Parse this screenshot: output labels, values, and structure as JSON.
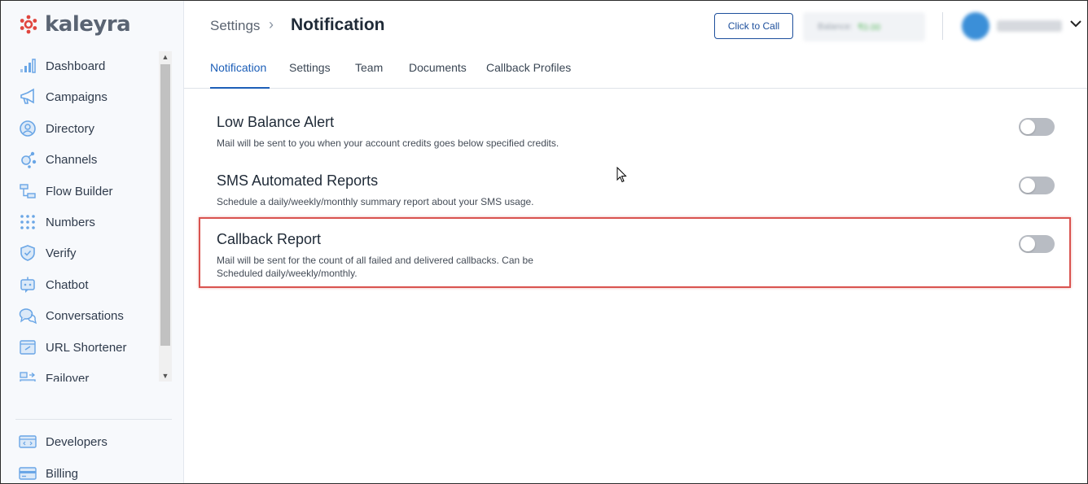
{
  "brand": {
    "name": "kaleyra",
    "accent": "#e0463f"
  },
  "sidebar": {
    "items": [
      {
        "label": "Dashboard",
        "icon": "bar-chart-icon"
      },
      {
        "label": "Campaigns",
        "icon": "megaphone-icon"
      },
      {
        "label": "Directory",
        "icon": "user-circle-icon"
      },
      {
        "label": "Channels",
        "icon": "channels-icon"
      },
      {
        "label": "Flow Builder",
        "icon": "flow-icon"
      },
      {
        "label": "Numbers",
        "icon": "keypad-icon"
      },
      {
        "label": "Verify",
        "icon": "shield-icon"
      },
      {
        "label": "Chatbot",
        "icon": "chatbot-icon"
      },
      {
        "label": "Conversations",
        "icon": "chat-bubbles-icon"
      },
      {
        "label": "URL Shortener",
        "icon": "link-icon"
      },
      {
        "label": "Failover",
        "icon": "failover-icon"
      }
    ],
    "bottom_items": [
      {
        "label": "Developers",
        "icon": "code-icon"
      },
      {
        "label": "Billing",
        "icon": "credit-card-icon"
      }
    ]
  },
  "header": {
    "breadcrumb_parent": "Settings",
    "breadcrumb_separator": "›",
    "page_title": "Notification",
    "click_to_call_label": "Click to Call",
    "balance_label": "Balance:",
    "balance_amount": "₹0.00"
  },
  "tabs": [
    {
      "label": "Notification",
      "active": true
    },
    {
      "label": "Settings",
      "active": false
    },
    {
      "label": "Team",
      "active": false
    },
    {
      "label": "Documents",
      "active": false
    },
    {
      "label": "Callback Profiles",
      "active": false
    }
  ],
  "notifications": [
    {
      "title": "Low Balance Alert",
      "description": "Mail will be sent to you when your account credits goes below specified credits.",
      "enabled": false
    },
    {
      "title": "SMS Automated Reports",
      "description": "Schedule a daily/weekly/monthly summary report about your SMS usage.",
      "enabled": false
    },
    {
      "title": "Callback Report",
      "description": "Mail will be sent for the count of all failed and delivered callbacks. Can be Scheduled daily/weekly/monthly.",
      "enabled": false,
      "highlighted": true
    }
  ],
  "colors": {
    "highlight": "#d9534f",
    "tab_active": "#1d5fb8",
    "toggle_off": "#b8bcc3"
  }
}
